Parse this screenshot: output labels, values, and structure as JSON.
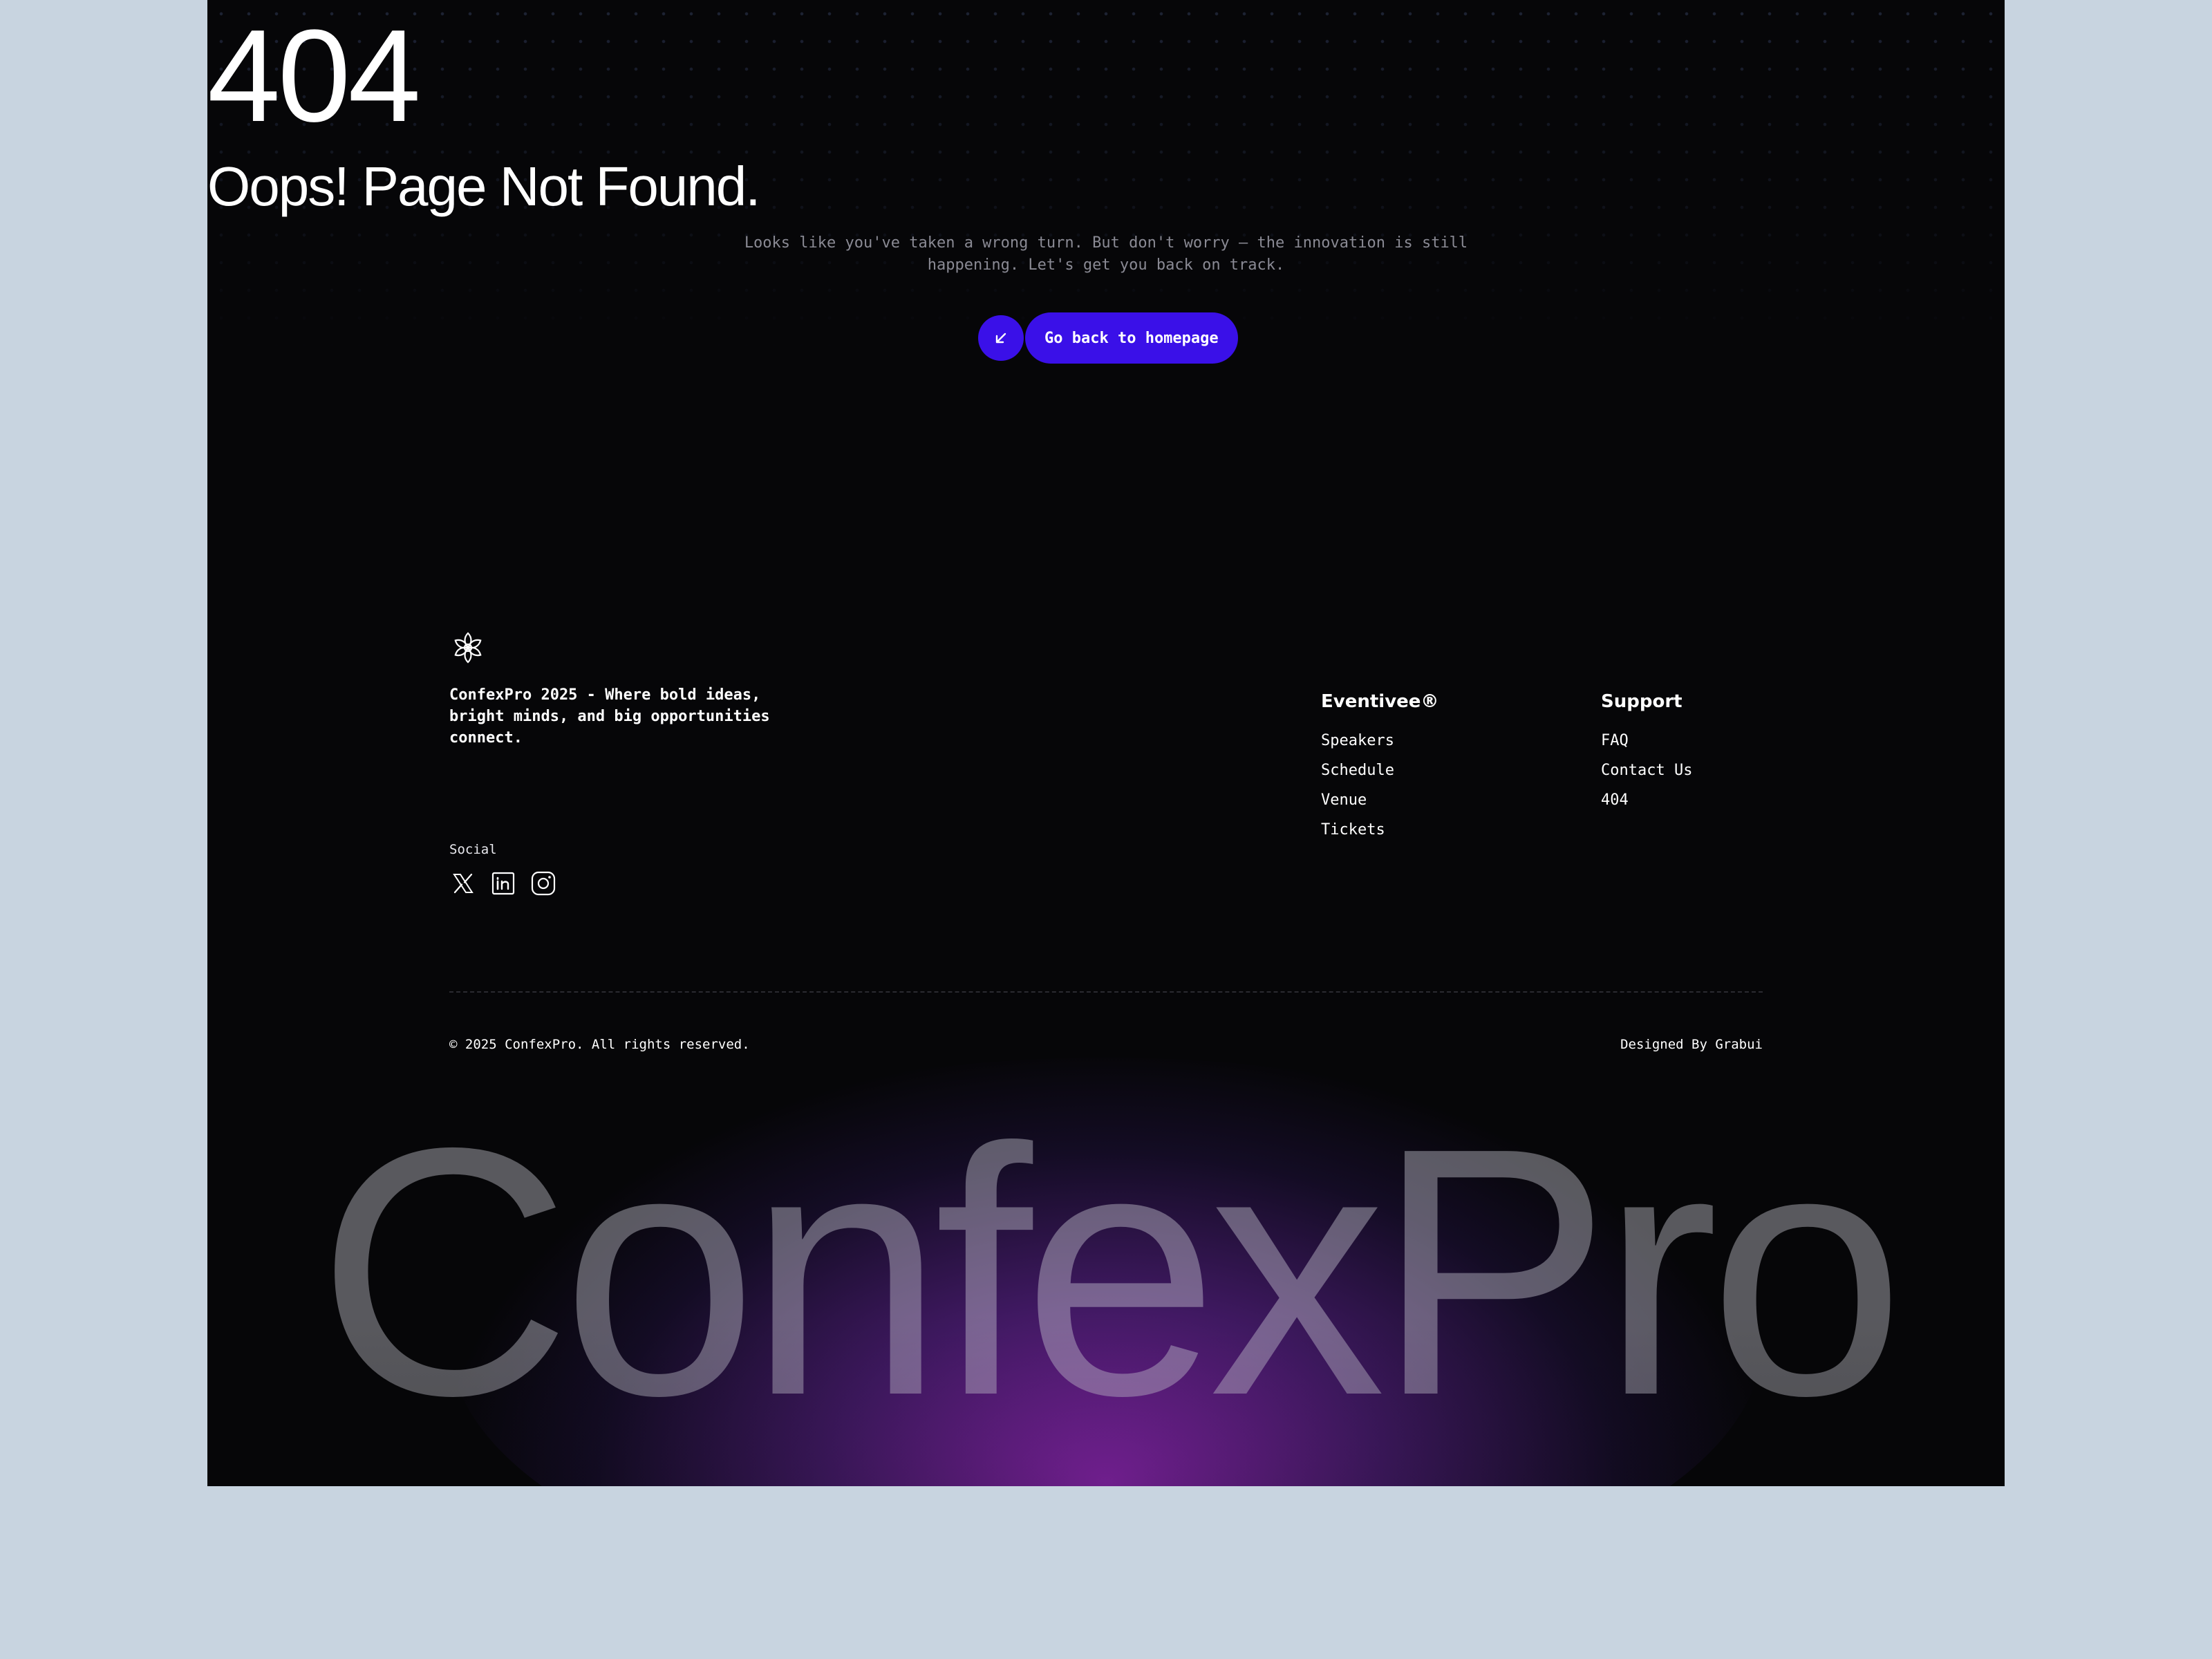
{
  "hero": {
    "code": "404",
    "title": "Oops! Page Not Found.",
    "description": "Looks like you've taken a wrong turn. But don't worry — the innovation is still happening. Let's get you back on track.",
    "cta_label": "Go back to homepage",
    "cta_icon": "arrow-down-left-icon",
    "accent_color": "#3a10e8"
  },
  "footer": {
    "tagline": "ConfexPro 2025 - Where bold ideas, bright minds, and big opportunities connect.",
    "social_label": "Social",
    "social_icons": [
      "x-icon",
      "linkedin-icon",
      "instagram-icon"
    ],
    "columns": [
      {
        "title": "Eventivee®",
        "links": [
          "Speakers",
          "Schedule",
          "Venue",
          "Tickets"
        ]
      },
      {
        "title": "Support",
        "links": [
          "FAQ",
          "Contact Us",
          "404"
        ]
      }
    ],
    "copyright": "© 2025 ConfexPro. All rights reserved.",
    "credit": "Designed By Grabui",
    "wordmark": "ConfexPro"
  }
}
